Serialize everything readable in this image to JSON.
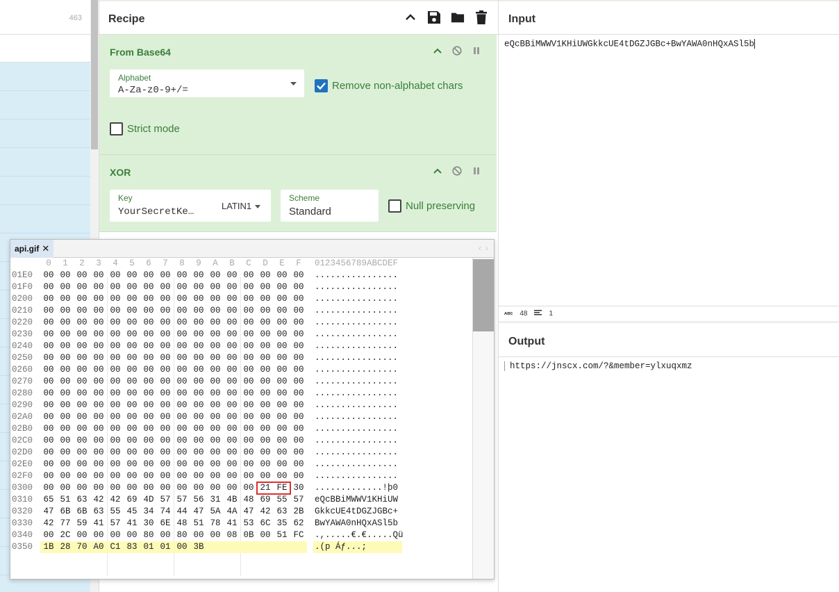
{
  "left": {
    "count": "463"
  },
  "recipe": {
    "title": "Recipe",
    "ops": [
      {
        "title": "From Base64",
        "alphabet_label": "Alphabet",
        "alphabet_value": "A-Za-z0-9+/=",
        "remove_label": "Remove non-alphabet chars",
        "strict_label": "Strict mode"
      },
      {
        "title": "XOR",
        "key_label": "Key",
        "key_value": "YourSecretKe…",
        "key_encoding": "LATIN1",
        "scheme_label": "Scheme",
        "scheme_value": "Standard",
        "null_label": "Null preserving"
      }
    ]
  },
  "input": {
    "title": "Input",
    "text": "eQcBBiMWWV1KHiUWGkkcUE4tDGZJGBc+BwYAWA0nHQxASl5b",
    "length": "48",
    "lines": "1"
  },
  "output": {
    "title": "Output",
    "text": "https://jnscx.com/?&member=ylxuqxmz"
  },
  "hex": {
    "tab": "api.gif",
    "header": [
      "0",
      "1",
      "2",
      "3",
      "4",
      "5",
      "6",
      "7",
      "8",
      "9",
      "A",
      "B",
      "C",
      "D",
      "E",
      "F"
    ],
    "header_ascii": "0123456789ABCDEF",
    "rows": [
      {
        "addr": "01E0",
        "bytes": [
          "00",
          "00",
          "00",
          "00",
          "00",
          "00",
          "00",
          "00",
          "00",
          "00",
          "00",
          "00",
          "00",
          "00",
          "00",
          "00"
        ],
        "ascii": "................"
      },
      {
        "addr": "01F0",
        "bytes": [
          "00",
          "00",
          "00",
          "00",
          "00",
          "00",
          "00",
          "00",
          "00",
          "00",
          "00",
          "00",
          "00",
          "00",
          "00",
          "00"
        ],
        "ascii": "................"
      },
      {
        "addr": "0200",
        "bytes": [
          "00",
          "00",
          "00",
          "00",
          "00",
          "00",
          "00",
          "00",
          "00",
          "00",
          "00",
          "00",
          "00",
          "00",
          "00",
          "00"
        ],
        "ascii": "................"
      },
      {
        "addr": "0210",
        "bytes": [
          "00",
          "00",
          "00",
          "00",
          "00",
          "00",
          "00",
          "00",
          "00",
          "00",
          "00",
          "00",
          "00",
          "00",
          "00",
          "00"
        ],
        "ascii": "................"
      },
      {
        "addr": "0220",
        "bytes": [
          "00",
          "00",
          "00",
          "00",
          "00",
          "00",
          "00",
          "00",
          "00",
          "00",
          "00",
          "00",
          "00",
          "00",
          "00",
          "00"
        ],
        "ascii": "................"
      },
      {
        "addr": "0230",
        "bytes": [
          "00",
          "00",
          "00",
          "00",
          "00",
          "00",
          "00",
          "00",
          "00",
          "00",
          "00",
          "00",
          "00",
          "00",
          "00",
          "00"
        ],
        "ascii": "................"
      },
      {
        "addr": "0240",
        "bytes": [
          "00",
          "00",
          "00",
          "00",
          "00",
          "00",
          "00",
          "00",
          "00",
          "00",
          "00",
          "00",
          "00",
          "00",
          "00",
          "00"
        ],
        "ascii": "................"
      },
      {
        "addr": "0250",
        "bytes": [
          "00",
          "00",
          "00",
          "00",
          "00",
          "00",
          "00",
          "00",
          "00",
          "00",
          "00",
          "00",
          "00",
          "00",
          "00",
          "00"
        ],
        "ascii": "................"
      },
      {
        "addr": "0260",
        "bytes": [
          "00",
          "00",
          "00",
          "00",
          "00",
          "00",
          "00",
          "00",
          "00",
          "00",
          "00",
          "00",
          "00",
          "00",
          "00",
          "00"
        ],
        "ascii": "................"
      },
      {
        "addr": "0270",
        "bytes": [
          "00",
          "00",
          "00",
          "00",
          "00",
          "00",
          "00",
          "00",
          "00",
          "00",
          "00",
          "00",
          "00",
          "00",
          "00",
          "00"
        ],
        "ascii": "................"
      },
      {
        "addr": "0280",
        "bytes": [
          "00",
          "00",
          "00",
          "00",
          "00",
          "00",
          "00",
          "00",
          "00",
          "00",
          "00",
          "00",
          "00",
          "00",
          "00",
          "00"
        ],
        "ascii": "................"
      },
      {
        "addr": "0290",
        "bytes": [
          "00",
          "00",
          "00",
          "00",
          "00",
          "00",
          "00",
          "00",
          "00",
          "00",
          "00",
          "00",
          "00",
          "00",
          "00",
          "00"
        ],
        "ascii": "................"
      },
      {
        "addr": "02A0",
        "bytes": [
          "00",
          "00",
          "00",
          "00",
          "00",
          "00",
          "00",
          "00",
          "00",
          "00",
          "00",
          "00",
          "00",
          "00",
          "00",
          "00"
        ],
        "ascii": "................"
      },
      {
        "addr": "02B0",
        "bytes": [
          "00",
          "00",
          "00",
          "00",
          "00",
          "00",
          "00",
          "00",
          "00",
          "00",
          "00",
          "00",
          "00",
          "00",
          "00",
          "00"
        ],
        "ascii": "................"
      },
      {
        "addr": "02C0",
        "bytes": [
          "00",
          "00",
          "00",
          "00",
          "00",
          "00",
          "00",
          "00",
          "00",
          "00",
          "00",
          "00",
          "00",
          "00",
          "00",
          "00"
        ],
        "ascii": "................"
      },
      {
        "addr": "02D0",
        "bytes": [
          "00",
          "00",
          "00",
          "00",
          "00",
          "00",
          "00",
          "00",
          "00",
          "00",
          "00",
          "00",
          "00",
          "00",
          "00",
          "00"
        ],
        "ascii": "................"
      },
      {
        "addr": "02E0",
        "bytes": [
          "00",
          "00",
          "00",
          "00",
          "00",
          "00",
          "00",
          "00",
          "00",
          "00",
          "00",
          "00",
          "00",
          "00",
          "00",
          "00"
        ],
        "ascii": "................"
      },
      {
        "addr": "02F0",
        "bytes": [
          "00",
          "00",
          "00",
          "00",
          "00",
          "00",
          "00",
          "00",
          "00",
          "00",
          "00",
          "00",
          "00",
          "00",
          "00",
          "00"
        ],
        "ascii": "................"
      },
      {
        "addr": "0300",
        "bytes": [
          "00",
          "00",
          "00",
          "00",
          "00",
          "00",
          "00",
          "00",
          "00",
          "00",
          "00",
          "00",
          "00",
          "21",
          "FE",
          "30"
        ],
        "ascii": ".............!þ0"
      },
      {
        "addr": "0310",
        "bytes": [
          "65",
          "51",
          "63",
          "42",
          "42",
          "69",
          "4D",
          "57",
          "57",
          "56",
          "31",
          "4B",
          "48",
          "69",
          "55",
          "57"
        ],
        "ascii": "eQcBBiMWWV1KHiUW"
      },
      {
        "addr": "0320",
        "bytes": [
          "47",
          "6B",
          "6B",
          "63",
          "55",
          "45",
          "34",
          "74",
          "44",
          "47",
          "5A",
          "4A",
          "47",
          "42",
          "63",
          "2B"
        ],
        "ascii": "GkkcUE4tDGZJGBc+"
      },
      {
        "addr": "0330",
        "bytes": [
          "42",
          "77",
          "59",
          "41",
          "57",
          "41",
          "30",
          "6E",
          "48",
          "51",
          "78",
          "41",
          "53",
          "6C",
          "35",
          "62"
        ],
        "ascii": "BwYAWA0nHQxASl5b"
      },
      {
        "addr": "0340",
        "bytes": [
          "00",
          "2C",
          "00",
          "00",
          "00",
          "00",
          "80",
          "00",
          "80",
          "00",
          "00",
          "08",
          "0B",
          "00",
          "51",
          "FC"
        ],
        "ascii": ".,.....€.€.....Qü"
      },
      {
        "addr": "0350",
        "bytes": [
          "1B",
          "28",
          "70",
          "A0",
          "C1",
          "83",
          "01",
          "01",
          "00",
          "3B"
        ],
        "ascii": ".(p Áƒ...;"
      }
    ]
  }
}
